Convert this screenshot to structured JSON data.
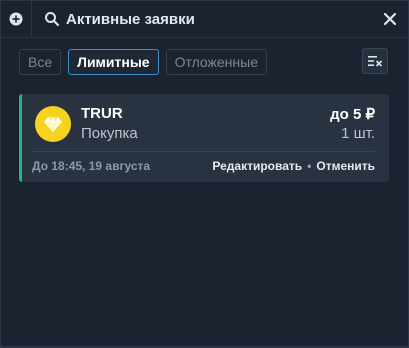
{
  "header": {
    "search_placeholder": "Активные заявки"
  },
  "tabs": [
    {
      "label": "Все",
      "active": false
    },
    {
      "label": "Лимитные",
      "active": true
    },
    {
      "label": "Отложенные",
      "active": false
    }
  ],
  "order": {
    "ticker": "TRUR",
    "side": "Покупка",
    "price": "до 5 ₽",
    "quantity": "1 шт.",
    "valid_until": "До 18:45, 19 августа",
    "edit_label": "Редактировать",
    "separator": "•",
    "cancel_label": "Отменить",
    "icon": "diamond-icon",
    "accent": "#21b58a",
    "coin_color": "#f7d321"
  },
  "colors": {
    "background": "#1b2330",
    "card": "#283241",
    "active_tab_border": "#3d8fc7"
  }
}
